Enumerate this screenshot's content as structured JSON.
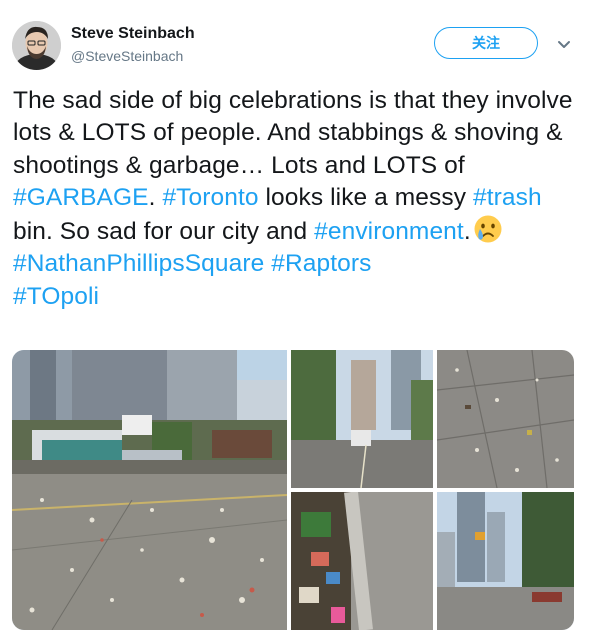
{
  "author": {
    "name": "Steve Steinbach",
    "handle": "@SteveSteinbach"
  },
  "follow_label": "关注",
  "tweet": {
    "text_1": "The sad side of big celebrations is that they involve lots & LOTS of people. And stabbings & shoving & shootings & garbage… Lots and LOTS of ",
    "hashtag_garbage": "#GARBAGE",
    "text_2": ". ",
    "hashtag_toronto": "#Toronto",
    "text_3": " looks like a messy ",
    "hashtag_trash": "#trash",
    "text_4": " bin. So sad for our city and ",
    "hashtag_environment": "#environment",
    "text_5": ".",
    "emoji": "crying-face",
    "hashtag_nps": "#NathanPhillipsSquare",
    "hashtag_raptors": "#Raptors",
    "hashtag_topoli": "#TOpoli"
  },
  "colors": {
    "link": "#1da1f2",
    "text": "#14171a",
    "secondary": "#657786"
  },
  "icons": [
    "avatar",
    "chevron-down-icon",
    "crying-face-emoji"
  ]
}
